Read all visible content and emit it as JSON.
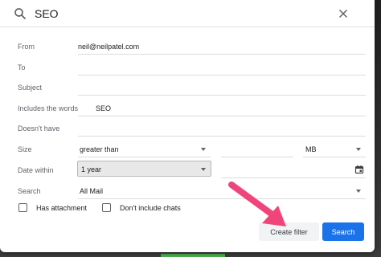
{
  "search": {
    "query": "SEO"
  },
  "fields": {
    "from": {
      "label": "From",
      "value": "neil@neilpatel.com"
    },
    "to": {
      "label": "To",
      "value": ""
    },
    "subject": {
      "label": "Subject",
      "value": ""
    },
    "includes": {
      "label": "Includes the words",
      "value": "SEO"
    },
    "doesnt_have": {
      "label": "Doesn't have",
      "value": ""
    },
    "size": {
      "label": "Size",
      "comparator": "greater than",
      "number": "",
      "unit": "MB"
    },
    "date_within": {
      "label": "Date within",
      "value": "1 year",
      "date": ""
    },
    "search_in": {
      "label": "Search",
      "value": "All Mail"
    }
  },
  "checkboxes": {
    "has_attachment": {
      "label": "Has attachment",
      "checked": false
    },
    "no_chats": {
      "label": "Don't include chats",
      "checked": false
    }
  },
  "buttons": {
    "create_filter": "Create filter",
    "search": "Search"
  },
  "colors": {
    "accent": "#1a73e8",
    "arrow": "#f0457a"
  },
  "icons": [
    "search-icon",
    "close-icon",
    "calendar-icon",
    "arrow-annotation"
  ]
}
